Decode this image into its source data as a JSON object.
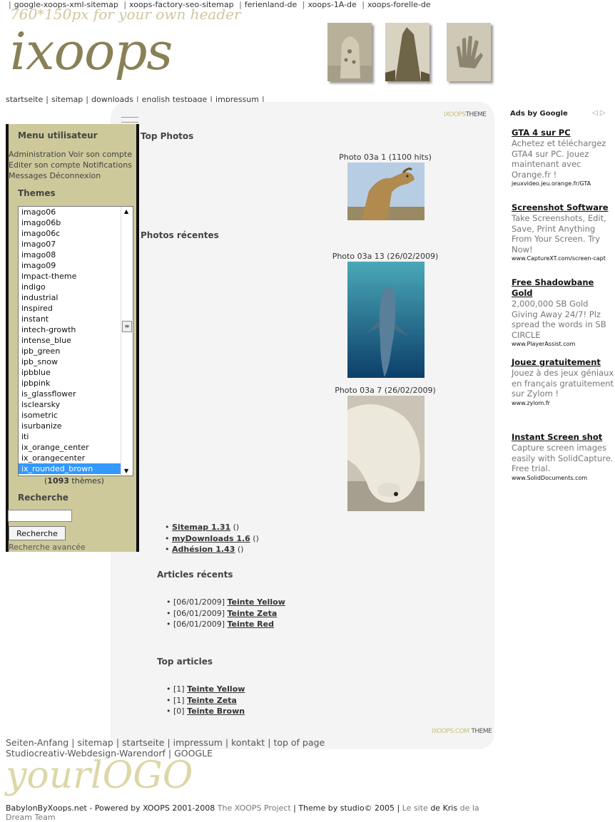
{
  "top_links": [
    "google-xoops-xml-sitemap",
    "xoops-factory-seo-sitemap",
    "ferienland-de",
    "xoops-1A-de",
    "xoops-forelle-de"
  ],
  "header": {
    "note": "760*150px for your own header",
    "logo": "ixoops"
  },
  "main_nav": [
    "startseite",
    "sitemap",
    "downloads",
    "english testpage",
    "impressum"
  ],
  "theme_badge": {
    "a": "IXOOPS",
    "b": "THEME",
    "a_bottom": "IXOOPS.COM",
    "b_bottom": "THEME"
  },
  "sidebar": {
    "user_menu_title": "Menu utilisateur",
    "user_menu_items": [
      "Administration",
      "Voir son compte",
      "Editer son compte",
      "Notifications",
      "Messages",
      "Déconnexion"
    ],
    "themes_title": "Themes",
    "themes": [
      "imago06",
      "imago06b",
      "imago06c",
      "imago07",
      "imago08",
      "imago09",
      "impact-theme",
      "indigo",
      "industrial",
      "inspired",
      "instant",
      "intech-growth",
      "intense_blue",
      "ipb_green",
      "ipb_snow",
      "ipbblue",
      "ipbpink",
      "is_glassflower",
      "isclearsky",
      "isometric",
      "isurbanize",
      "iti",
      "ix_orange_center",
      "ix_orangecenter",
      "ix_rounded_brown"
    ],
    "selected_theme": "ix_rounded_brown",
    "themes_count_open": "(",
    "themes_count_num": "1093",
    "themes_count_rest": " thèmes)",
    "search_title": "Recherche",
    "search_value": "",
    "search_button": "Recherche",
    "advanced_search": "Recherche avancée"
  },
  "center": {
    "top_photos_title": "Top Photos",
    "top_photo": {
      "title": "Photo 03a 1",
      "meta": " (1100 hits)"
    },
    "recent_photos_title": "Photos récentes",
    "recent_photos": [
      {
        "title": "Photo 03a 13",
        "meta": " (26/02/2009)"
      },
      {
        "title": "Photo 03a 7",
        "meta": " (26/02/2009)"
      }
    ],
    "modules": [
      {
        "name": "Sitemap 1.31",
        "extra": " ()"
      },
      {
        "name": "myDownloads 1.6",
        "extra": " ()"
      },
      {
        "name": "Adhésion 1.43",
        "extra": " ()"
      }
    ],
    "recent_articles_title": "Articles récents",
    "recent_articles": [
      {
        "date": "[06/01/2009] ",
        "title": "Teinte Yellow"
      },
      {
        "date": "[06/01/2009] ",
        "title": "Teinte Zeta"
      },
      {
        "date": "[06/01/2009] ",
        "title": "Teinte Red"
      }
    ],
    "top_articles_title": "Top articles",
    "top_articles": [
      {
        "count": "[1] ",
        "title": "Teinte Yellow"
      },
      {
        "count": "[1] ",
        "title": "Teinte Zeta"
      },
      {
        "count": "[0] ",
        "title": "Teinte Brown"
      }
    ]
  },
  "ads": {
    "header": "Ads by Google",
    "nav": "◁ ▷",
    "items": [
      {
        "title": "GTA 4 sur PC",
        "body": "Achetez et téléchargez GTA4 sur PC. Jouez maintenant avec Orange.fr !",
        "url": "jeuxvideo.jeu.orange.fr/GTA"
      },
      {
        "title": "Screenshot Software",
        "body": "Take Screenshots, Edit, Save, Print Anything From Your Screen. Try Now!",
        "url": "www.CaptureXT.com/screen-capt"
      },
      {
        "title": "Free Shadowbane Gold",
        "body": "2,000,000 SB Gold Giving Away 24/7! Plz spread the words in SB CIRCLE",
        "url": "www.PlayerAssist.com"
      },
      {
        "title": "Jouez gratuitement",
        "body": "Jouez à des jeux géniaux en français gratuitement sur Zylom !",
        "url": "www.zylom.fr"
      },
      {
        "title": "Instant Screen shot",
        "body": "Capture screen images easily with SolidCapture. Free trial.",
        "url": "www.SolidDocuments.com"
      }
    ]
  },
  "footer": {
    "nav": [
      "Seiten-Anfang",
      "sitemap",
      "startseite",
      "impressum",
      "kontakt",
      "top of page"
    ],
    "nav2": [
      "Studiocreativ-Webdesign-Warendorf",
      "GOOGLE"
    ],
    "logo": "yourlOGO",
    "copyright_a": "BabylonByXoops.net - Powered by XOOPS 2001-2008 ",
    "copyright_b": "The XOOPS Project",
    "copyright_c": " | Theme by studio© 2005 | ",
    "copyright_d": "Le site",
    "copyright_e": " de Kris ",
    "copyright_f": "de la Dream Team"
  },
  "colors": {
    "sidebar": "#cdc99a",
    "center_panel": "#f4f4f4",
    "logo": "#8a8056",
    "selected": "#3399ff"
  }
}
